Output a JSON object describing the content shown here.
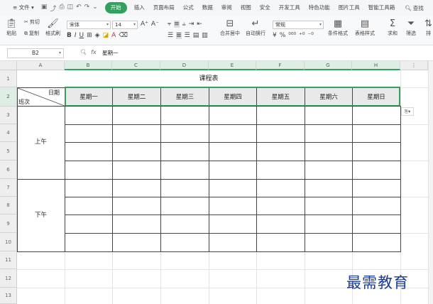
{
  "menubar": {
    "file": "文件",
    "items": [
      "开始",
      "插入",
      "页面布局",
      "公式",
      "数据",
      "审阅",
      "视图",
      "安全",
      "开发工具",
      "特色功能",
      "图片工具",
      "智能工具箱"
    ],
    "search": "查找"
  },
  "ribbon": {
    "paste": "粘贴",
    "cut": "剪切",
    "copy": "复制",
    "format_painter": "格式刷",
    "font_name": "宋体",
    "font_size": "14",
    "merge_center": "合并居中",
    "wrap_text": "自动换行",
    "number_format": "常规",
    "conditional_format": "条件格式",
    "table_style": "表格样式",
    "sum": "求和",
    "filter": "筛选",
    "sort": "排"
  },
  "formula_bar": {
    "cell_ref": "B2",
    "content": "星期一"
  },
  "grid": {
    "columns": [
      "A",
      "B",
      "C",
      "D",
      "E",
      "F",
      "G",
      "H"
    ],
    "rows": [
      "1",
      "2",
      "3",
      "4",
      "5",
      "6",
      "7",
      "8",
      "9",
      "10",
      "11",
      "12",
      "13"
    ]
  },
  "sheet": {
    "title": "课程表",
    "corner_top": "日期",
    "corner_bottom": "班次",
    "days": [
      "星期一",
      "星期二",
      "星期三",
      "星期四",
      "星期五",
      "星期六",
      "星期日"
    ],
    "morning": "上午",
    "afternoon": "下午"
  },
  "watermark": "最需教育"
}
